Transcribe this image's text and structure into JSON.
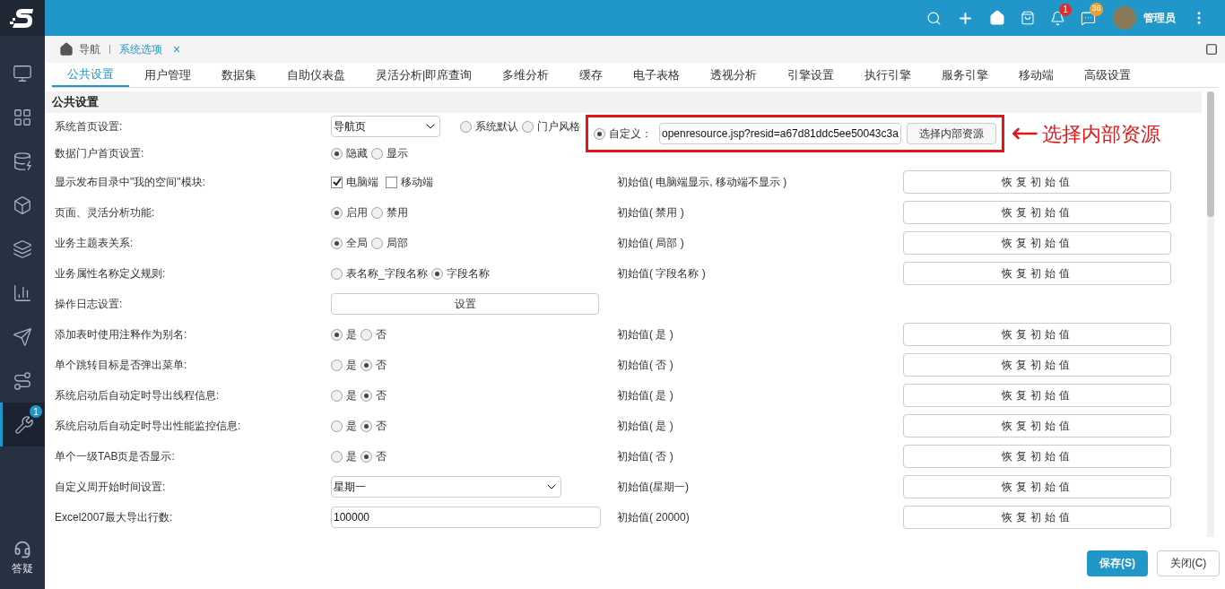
{
  "topbar": {
    "notifications_badge": "1",
    "messages_badge": "36",
    "user": "管理员"
  },
  "sidebar": {
    "items": [
      {
        "kind": "monitor",
        "selected": false
      },
      {
        "kind": "apps",
        "selected": false
      },
      {
        "kind": "database",
        "selected": false
      },
      {
        "kind": "cube",
        "selected": false
      },
      {
        "kind": "layers",
        "selected": false
      },
      {
        "kind": "chart",
        "selected": false
      },
      {
        "kind": "send",
        "selected": false
      },
      {
        "kind": "route",
        "selected": false
      },
      {
        "kind": "tools",
        "selected": true,
        "badge": "1"
      }
    ],
    "help": "答疑"
  },
  "breadcrumb": {
    "home": "导航",
    "tab": "系统选项",
    "close": "×"
  },
  "tabs": [
    {
      "label": "公共设置",
      "selected": true
    },
    {
      "label": "用户管理",
      "selected": false
    },
    {
      "label": "数据集",
      "selected": false
    },
    {
      "label": "自助仪表盘",
      "selected": false
    },
    {
      "label": "灵活分析|即席查询",
      "selected": false
    },
    {
      "label": "多维分析",
      "selected": false
    },
    {
      "label": "缓存",
      "selected": false
    },
    {
      "label": "电子表格",
      "selected": false
    },
    {
      "label": "透视分析",
      "selected": false
    },
    {
      "label": "引擎设置",
      "selected": false
    },
    {
      "label": "执行引擎",
      "selected": false
    },
    {
      "label": "服务引擎",
      "selected": false
    },
    {
      "label": "移动端",
      "selected": false
    },
    {
      "label": "高级设置",
      "selected": false
    }
  ],
  "section": "公共设置",
  "rows": [
    {
      "kind": "homepage",
      "label": "系统首页设置:",
      "select": "导航页",
      "options": [
        {
          "label": "系统默认",
          "selected": false
        },
        {
          "label": "门户风格",
          "selected": false
        },
        {
          "label": "自定义：",
          "selected": true
        }
      ],
      "input": "openresource.jsp?resid=a67d81ddc5ee50043c3a",
      "button": "选择内部资源",
      "annotation": "选择内部资源"
    },
    {
      "kind": "radio",
      "label": "数据门户首页设置:",
      "options": [
        {
          "label": "隐藏",
          "selected": true
        },
        {
          "label": "显示",
          "selected": false
        }
      ]
    },
    {
      "kind": "checkbox",
      "label": "显示发布目录中\"我的空间\"模块:",
      "options": [
        {
          "label": "电脑端",
          "checked": true
        },
        {
          "label": "移动端",
          "checked": false
        }
      ],
      "initial": "初始值( 电脑端显示, 移动端不显示 )",
      "reset": "恢复初始值"
    },
    {
      "kind": "radio",
      "label": "页面、灵活分析功能:",
      "options": [
        {
          "label": "启用",
          "selected": true
        },
        {
          "label": "禁用",
          "selected": false
        }
      ],
      "initial": "初始值( 禁用 )",
      "reset": "恢复初始值"
    },
    {
      "kind": "radio",
      "label": "业务主题表关系:",
      "options": [
        {
          "label": "全局",
          "selected": true
        },
        {
          "label": "局部",
          "selected": false
        }
      ],
      "initial": "初始值( 局部 )",
      "reset": "恢复初始值"
    },
    {
      "kind": "radio",
      "label": "业务属性名称定义规则:",
      "options": [
        {
          "label": "表名称_字段名称",
          "selected": false
        },
        {
          "label": "字段名称",
          "selected": true
        }
      ],
      "initial": "初始值( 字段名称 )",
      "reset": "恢复初始值"
    },
    {
      "kind": "button",
      "label": "操作日志设置:",
      "button": "设置"
    },
    {
      "kind": "radio",
      "label": "添加表时使用注释作为别名:",
      "options": [
        {
          "label": "是",
          "selected": true
        },
        {
          "label": "否",
          "selected": false
        }
      ],
      "initial": "初始值( 是 )",
      "reset": "恢复初始值"
    },
    {
      "kind": "radio",
      "label": "单个跳转目标是否弹出菜单:",
      "options": [
        {
          "label": "是",
          "selected": false
        },
        {
          "label": "否",
          "selected": true
        }
      ],
      "initial": "初始值( 否 )",
      "reset": "恢复初始值"
    },
    {
      "kind": "radio",
      "label": "系统启动后自动定时导出线程信息:",
      "options": [
        {
          "label": "是",
          "selected": false
        },
        {
          "label": "否",
          "selected": true
        }
      ],
      "initial": "初始值( 是 )",
      "reset": "恢复初始值"
    },
    {
      "kind": "radio",
      "label": "系统启动后自动定时导出性能监控信息:",
      "options": [
        {
          "label": "是",
          "selected": false
        },
        {
          "label": "否",
          "selected": true
        }
      ],
      "initial": "初始值( 是 )",
      "reset": "恢复初始值"
    },
    {
      "kind": "radio",
      "label": "单个一级TAB页是否显示:",
      "options": [
        {
          "label": "是",
          "selected": false
        },
        {
          "label": "否",
          "selected": true
        }
      ],
      "initial": "初始值( 否 )",
      "reset": "恢复初始值"
    },
    {
      "kind": "select",
      "label": "自定义周开始时间设置:",
      "select": "星期一",
      "initial": "初始值(星期一)",
      "reset": "恢复初始值"
    },
    {
      "kind": "input",
      "label": "Excel2007最大导出行数:",
      "input": "100000",
      "initial": "初始值( 20000)",
      "reset": "恢复初始值"
    }
  ],
  "footer": {
    "save": "保存(S)",
    "close": "关闭(C)"
  }
}
